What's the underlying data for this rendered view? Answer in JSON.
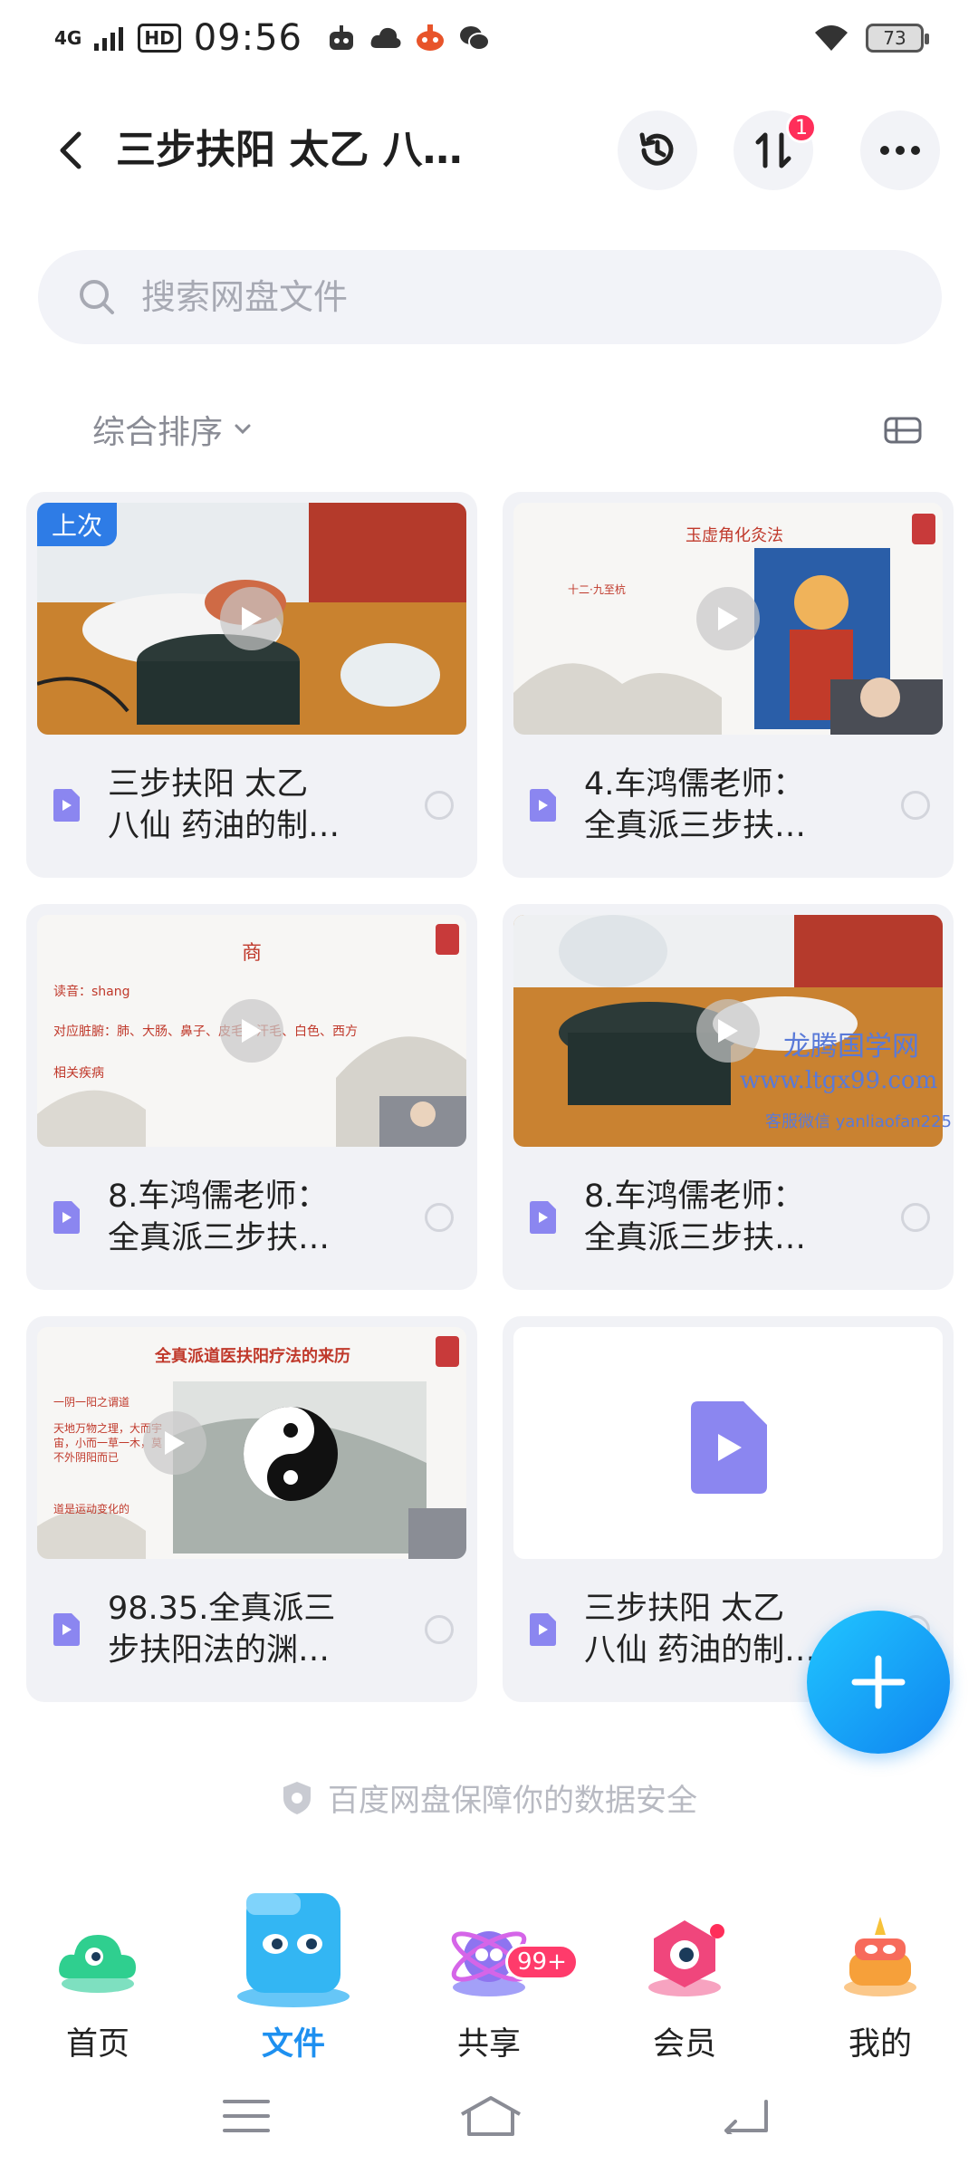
{
  "status_bar": {
    "network": "4G",
    "hd": "HD",
    "time": "09:56",
    "battery": "73"
  },
  "header": {
    "title": "三步扶阳 太乙 八…",
    "transfer_badge": "1"
  },
  "search": {
    "placeholder": "搜索网盘文件"
  },
  "sort": {
    "label": "综合排序"
  },
  "files": [
    {
      "name": "三步扶阳 太乙\n八仙 药油的制…",
      "tag": "上次"
    },
    {
      "name": "4.车鸿儒老师：\n全真派三步扶…",
      "thumb_title": "玉虚角化灸法"
    },
    {
      "name": "8.车鸿儒老师：\n全真派三步扶…",
      "thumb_title": "商",
      "thumb_lines": [
        "读音：shang",
        "对应脏腑：肺、大肠、鼻子、皮毛、汗毛、白色、西方",
        "相关疾病"
      ]
    },
    {
      "name": "8.车鸿儒老师：\n全真派三步扶…",
      "watermark": [
        "龙腾国学网",
        "www.ltgx99.com",
        "客服微信 yanliaofan225"
      ]
    },
    {
      "name": "98.35.全真派三\n步扶阳法的渊…",
      "thumb_title": "全真派道医扶阳疗法的来历",
      "thumb_lines": [
        "一阴一阳之谓道",
        "天地万物之理，大而宇宙，小而一草一木，莫不外阴阳而已",
        "道是运动变化的"
      ]
    },
    {
      "name": "三步扶阳 太乙\n八仙 药油的制…"
    }
  ],
  "footer_note": "百度网盘保障你的数据安全",
  "nav": [
    {
      "label": "首页"
    },
    {
      "label": "文件"
    },
    {
      "label": "共享",
      "badge": "99+"
    },
    {
      "label": "会员"
    },
    {
      "label": "我的"
    }
  ],
  "colors": {
    "accent": "#1e90f0",
    "badge": "#ff2e5a",
    "card_bg": "#f1f2f6",
    "file_icon": "#8b86f0"
  }
}
